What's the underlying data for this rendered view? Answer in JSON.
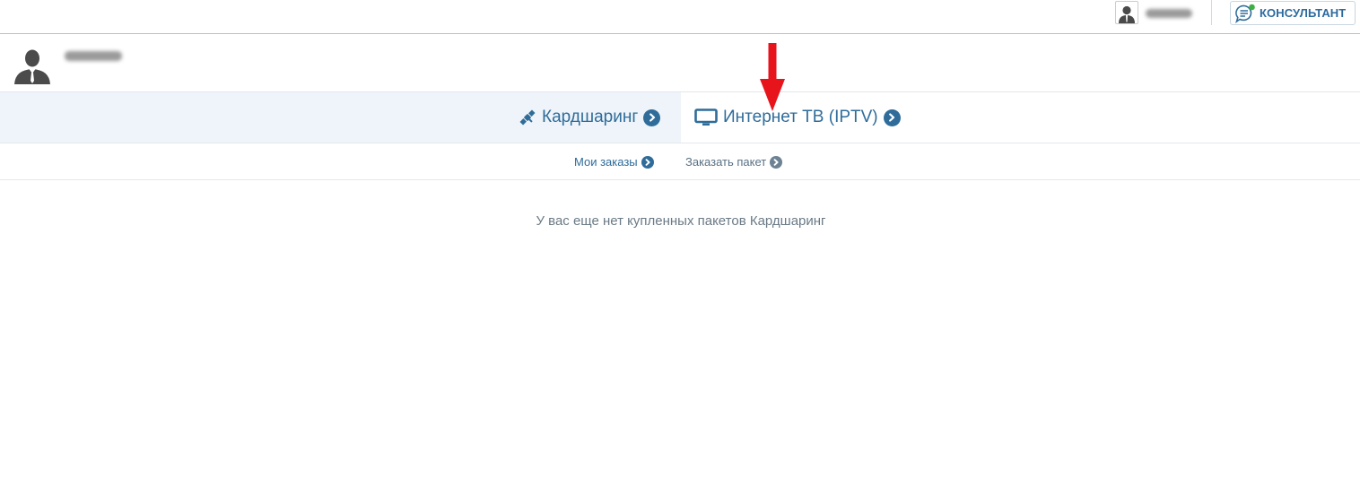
{
  "topbar": {
    "user_name_masked": "",
    "consultant_label": "КОНСУЛЬТАНТ"
  },
  "profile": {
    "name_masked": ""
  },
  "services": {
    "tabs": [
      {
        "label": "Кардшаринг",
        "icon": "satellite-icon",
        "active": true
      },
      {
        "label": "Интернет ТВ (IPTV)",
        "icon": "monitor-icon",
        "active": false
      }
    ]
  },
  "subnav": {
    "items": [
      {
        "label": "Мои заказы",
        "active": true
      },
      {
        "label": "Заказать пакет",
        "active": false
      }
    ]
  },
  "main": {
    "empty_message": "У вас еще нет купленных пакетов Кардшаринг"
  },
  "colors": {
    "accent": "#2f6c9a",
    "active_band": "#eef4f9",
    "annotation_arrow": "#e8141c",
    "online_dot": "#3cb043"
  }
}
